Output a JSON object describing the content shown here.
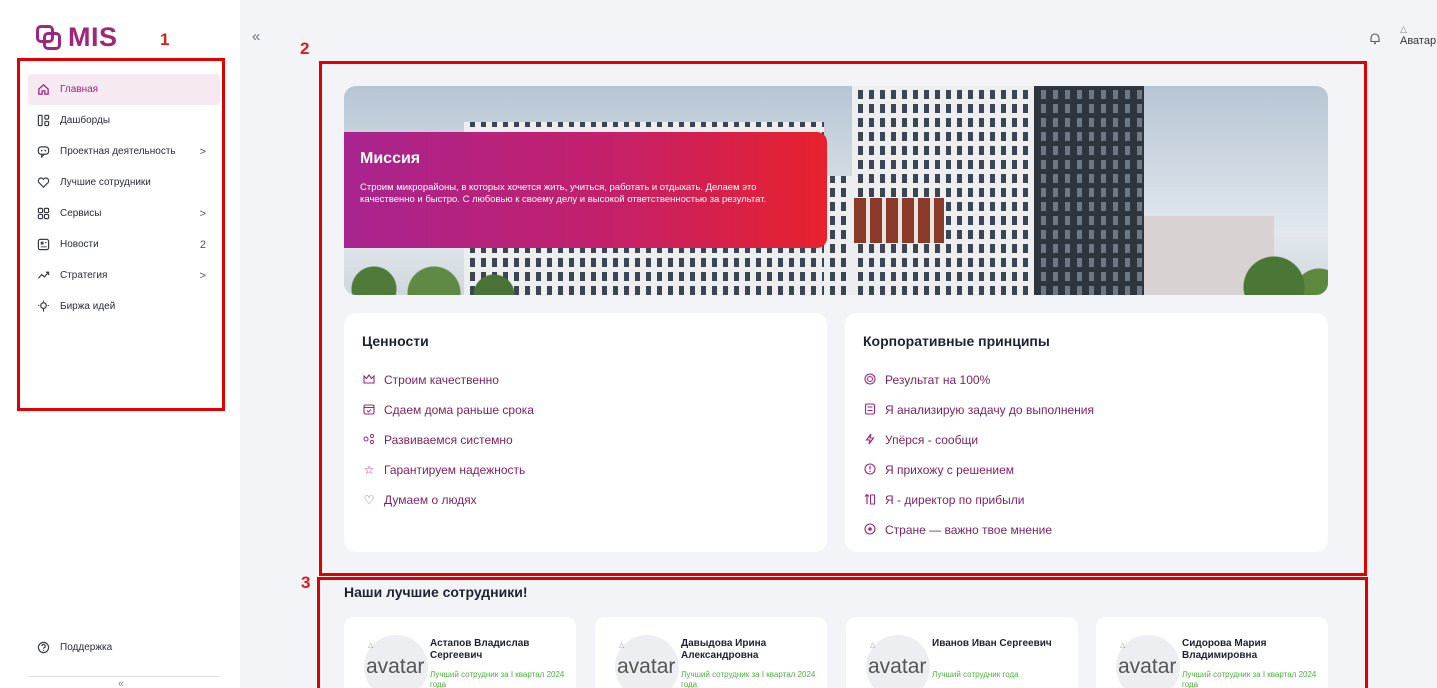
{
  "app": {
    "logo_text": "MIS"
  },
  "annotations": {
    "a1": "1",
    "a2": "2",
    "a3": "3"
  },
  "sidebar": {
    "items": [
      {
        "label": "Главная",
        "icon": "home-icon",
        "active": true,
        "right": ""
      },
      {
        "label": "Дашборды",
        "icon": "dashboard-icon",
        "right": ""
      },
      {
        "label": "Проектная деятельность",
        "icon": "project-icon",
        "right": ">"
      },
      {
        "label": "Лучшие сотрудники",
        "icon": "heart-icon",
        "right": ""
      },
      {
        "label": "Сервисы",
        "icon": "grid-icon",
        "right": ">"
      },
      {
        "label": "Новости",
        "icon": "news-icon",
        "right": "2"
      },
      {
        "label": "Стратегия",
        "icon": "strategy-icon",
        "right": ">"
      },
      {
        "label": "Биржа идей",
        "icon": "bulb-icon",
        "right": ""
      }
    ],
    "support_label": "Поддержка",
    "collapse_bottom": "«"
  },
  "topbar": {
    "collapse": "«",
    "avatar_alt": "Аватар"
  },
  "mission": {
    "title": "Миссия",
    "text": "Строим микрорайоны, в которых хочется жить, учиться, работать и отдыхать. Делаем это качественно и быстро. С любовью к своему делу и высокой ответственностью за результат."
  },
  "values": {
    "title": "Ценности",
    "items": [
      {
        "label": "Строим качественно",
        "icon": "crown-icon"
      },
      {
        "label": "Сдаем дома раньше срока",
        "icon": "calendar-icon"
      },
      {
        "label": "Развиваемся системно",
        "icon": "nodes-icon"
      },
      {
        "label": "Гарантируем надежность",
        "icon": "star-icon"
      },
      {
        "label": "Думаем о людях",
        "icon": "heart-icon"
      }
    ]
  },
  "principles": {
    "title": "Корпоративные принципы",
    "items": [
      {
        "label": "Результат на 100%",
        "icon": "target-icon"
      },
      {
        "label": "Я анализирую задачу до выполнения",
        "icon": "calculator-icon"
      },
      {
        "label": "Упёрся - сообщи",
        "icon": "lightning-icon"
      },
      {
        "label": "Я прихожу с решением",
        "icon": "alert-icon"
      },
      {
        "label": "Я - директор по прибыли",
        "icon": "chart-up-icon"
      },
      {
        "label": "Стране — важно твое мнение",
        "icon": "eye-icon"
      }
    ]
  },
  "best_employees": {
    "title": "Наши лучшие сотрудники!",
    "avatar_alt": "avatar",
    "cards": [
      {
        "name": "Астапов Владислав Сергеевич",
        "role": "Лучший сотрудник за I квартал 2024 года"
      },
      {
        "name": "Давыдова Ирина Александровна",
        "role": "Лучший сотрудник за I квартал 2024 года"
      },
      {
        "name": "Иванов Иван Сергеевич",
        "role": "Лучший сотрудник года"
      },
      {
        "name": "Сидорова Мария Владимировна",
        "role": "Лучший сотрудник за I квартал 2024 года"
      }
    ]
  }
}
